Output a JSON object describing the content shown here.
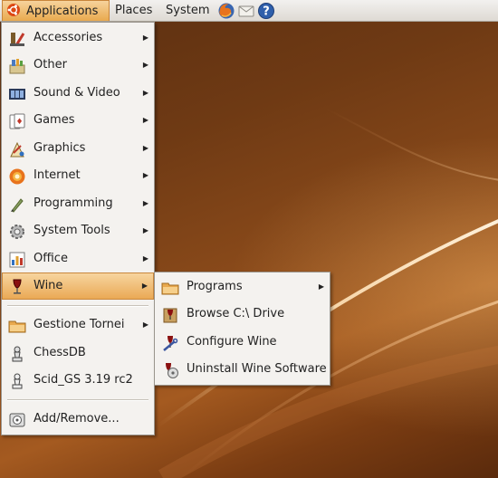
{
  "top_panel": {
    "applications_label": "Applications",
    "places_label": "Places",
    "system_label": "System",
    "launchers": [
      {
        "icon": "firefox-icon"
      },
      {
        "icon": "mail-icon"
      },
      {
        "icon": "help-icon"
      }
    ]
  },
  "applications_menu": {
    "items": [
      {
        "label": "Accessories",
        "icon": "accessories-icon",
        "has_submenu": true
      },
      {
        "label": "Other",
        "icon": "other-icon",
        "has_submenu": true
      },
      {
        "label": "Sound & Video",
        "icon": "sound-video-icon",
        "has_submenu": true
      },
      {
        "label": "Games",
        "icon": "games-icon",
        "has_submenu": true
      },
      {
        "label": "Graphics",
        "icon": "graphics-icon",
        "has_submenu": true
      },
      {
        "label": "Internet",
        "icon": "internet-icon",
        "has_submenu": true
      },
      {
        "label": "Programming",
        "icon": "programming-icon",
        "has_submenu": true
      },
      {
        "label": "System Tools",
        "icon": "system-tools-icon",
        "has_submenu": true
      },
      {
        "label": "Office",
        "icon": "office-icon",
        "has_submenu": true
      },
      {
        "label": "Wine",
        "icon": "wine-icon",
        "has_submenu": true,
        "highlighted": true
      },
      {
        "label": "Gestione Tornei",
        "icon": "folder-icon",
        "has_submenu": true
      },
      {
        "label": "ChessDB",
        "icon": "chessdb-icon",
        "has_submenu": false
      },
      {
        "label": "Scid_GS 3.19 rc2",
        "icon": "scid-icon",
        "has_submenu": false
      },
      {
        "label": "Add/Remove...",
        "icon": "add-remove-icon",
        "has_submenu": false
      }
    ]
  },
  "wine_submenu": {
    "items": [
      {
        "label": "Programs",
        "icon": "folder-icon",
        "has_submenu": true
      },
      {
        "label": "Browse C:\\ Drive",
        "icon": "wine-browse-icon",
        "has_submenu": false
      },
      {
        "label": "Configure Wine",
        "icon": "wine-config-icon",
        "has_submenu": false
      },
      {
        "label": "Uninstall Wine Software",
        "icon": "wine-uninstall-icon",
        "has_submenu": false
      }
    ]
  },
  "colors": {
    "highlight": "#eaa955",
    "menu_bg": "#f4f2ef",
    "desktop": "#7a3c12"
  }
}
